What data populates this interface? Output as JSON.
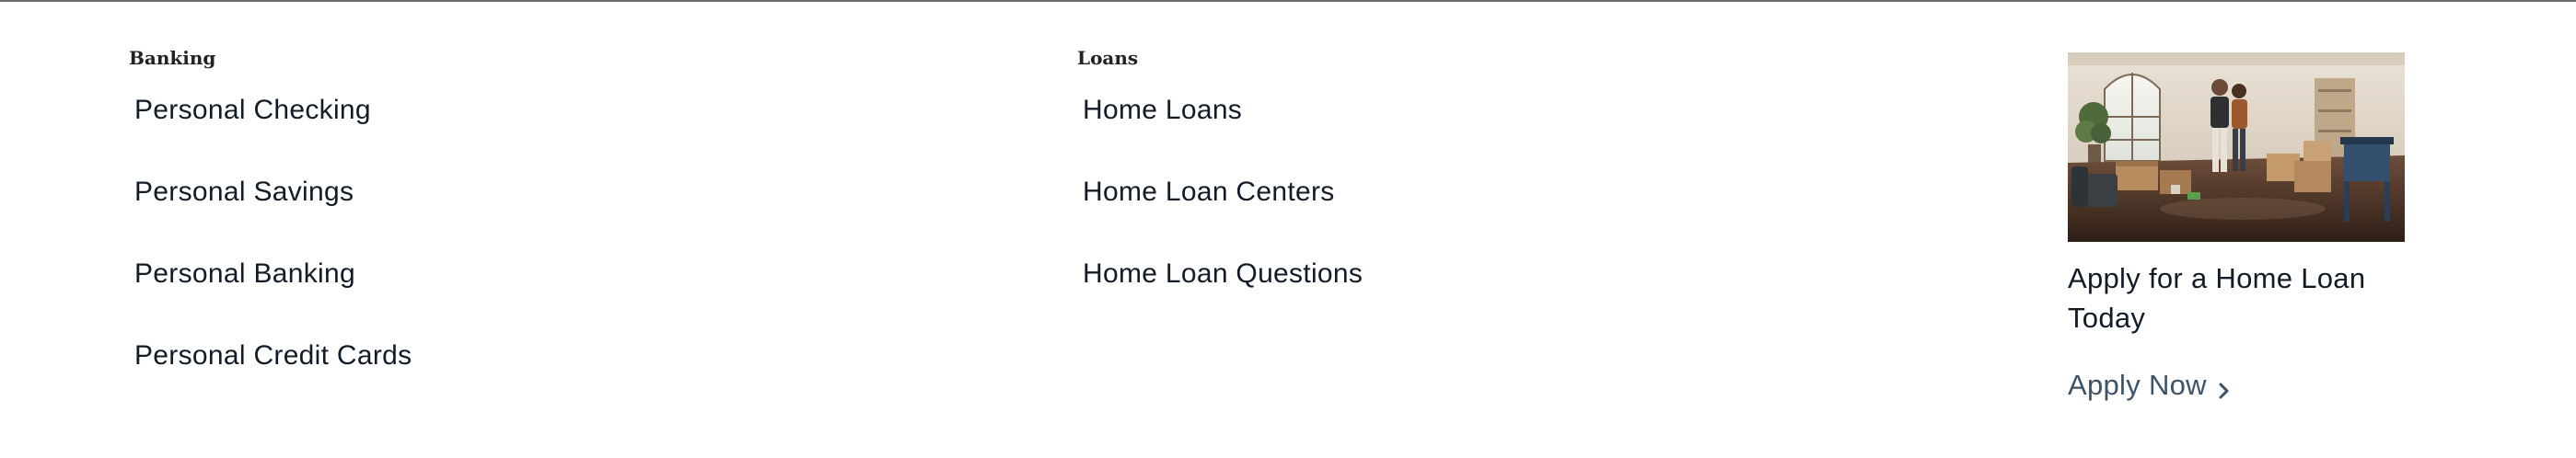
{
  "banking": {
    "heading": "Banking",
    "links": [
      {
        "label": "Personal Checking"
      },
      {
        "label": "Personal Savings"
      },
      {
        "label": "Personal Banking"
      },
      {
        "label": "Personal Credit Cards"
      }
    ]
  },
  "loans": {
    "heading": "Loans",
    "links": [
      {
        "label": "Home Loans"
      },
      {
        "label": "Home Loan Centers"
      },
      {
        "label": "Home Loan Questions"
      }
    ]
  },
  "promo": {
    "title": "Apply for a Home Loan Today",
    "cta_label": "Apply Now",
    "cta_icon": "chevron-right-icon"
  },
  "colors": {
    "text": "#121c28",
    "cta": "#3e5266",
    "divider": "#6b6b6b"
  }
}
